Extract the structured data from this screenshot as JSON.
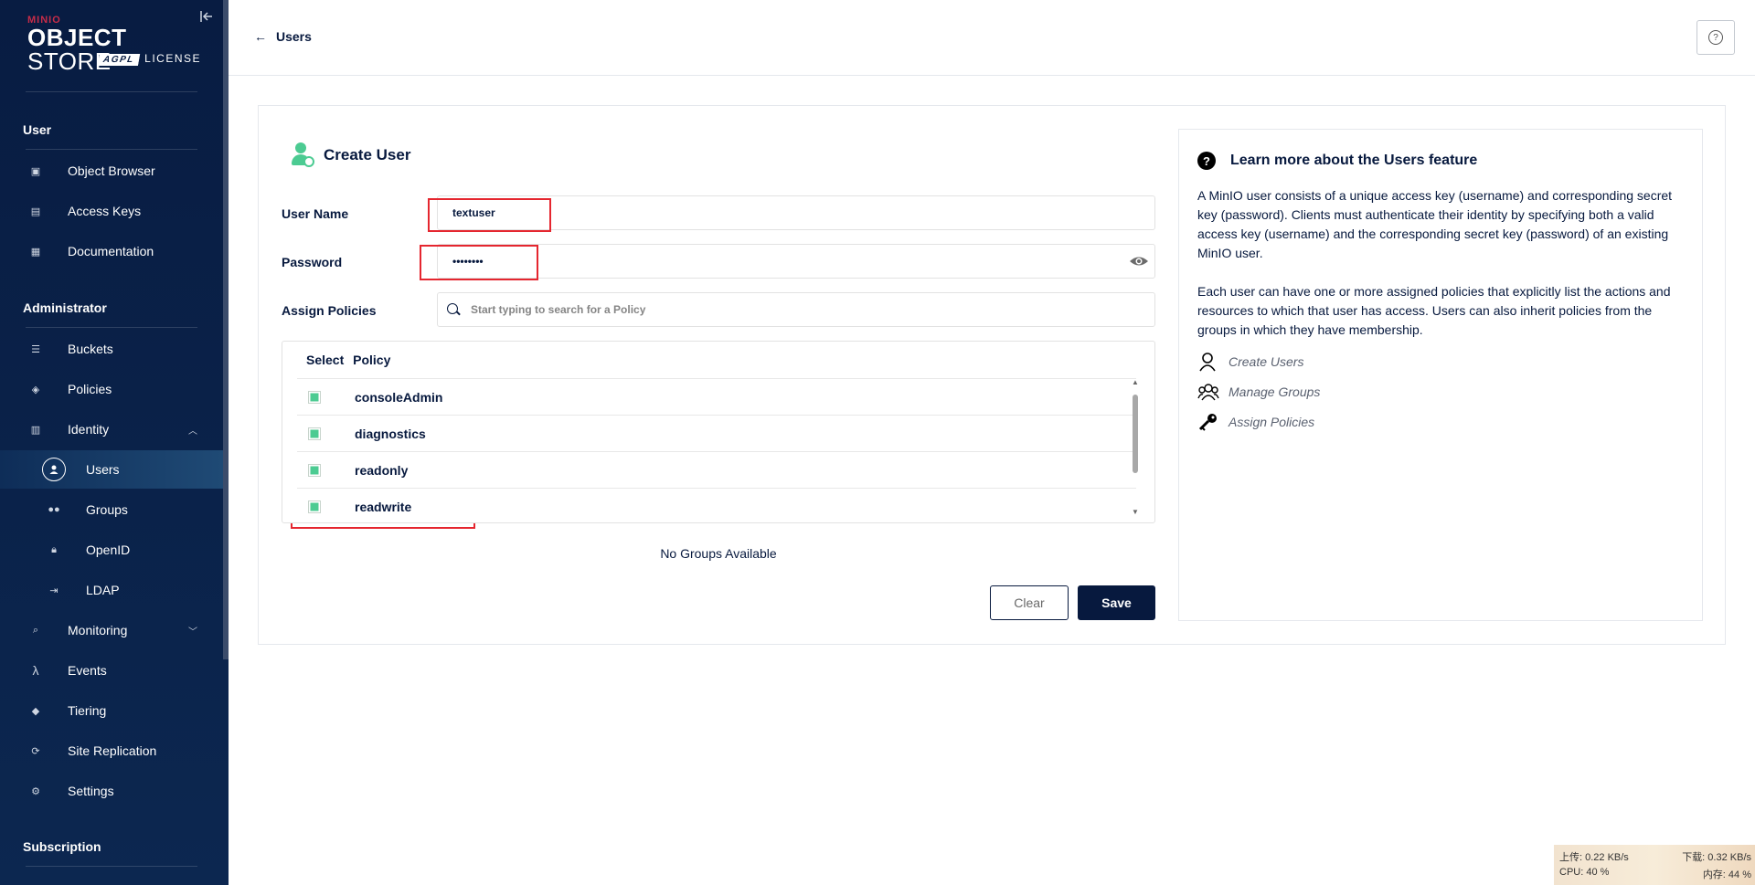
{
  "sidebar": {
    "logo": {
      "small": "MINIO",
      "big_bold": "OBJECT",
      "big_thin": "STORE",
      "agpl": "AGPL",
      "license": "LICENSE"
    },
    "collapse_icon": "collapse-icon",
    "sections": {
      "user": "User",
      "administrator": "Administrator",
      "subscription": "Subscription"
    },
    "items": {
      "object_browser": "Object Browser",
      "access_keys": "Access Keys",
      "documentation": "Documentation",
      "buckets": "Buckets",
      "policies": "Policies",
      "identity": "Identity",
      "users": "Users",
      "groups": "Groups",
      "openid": "OpenID",
      "ldap": "LDAP",
      "monitoring": "Monitoring",
      "events": "Events",
      "tiering": "Tiering",
      "site_replication": "Site Replication",
      "settings": "Settings"
    }
  },
  "topbar": {
    "back_label": "Users"
  },
  "form": {
    "title": "Create User",
    "username_label": "User Name",
    "username_value": "textuser",
    "password_label": "Password",
    "password_value": "••••••••",
    "policies_label": "Assign Policies",
    "policy_search_placeholder": "Start typing to search for a Policy",
    "table_headers": {
      "select": "Select",
      "policy": "Policy"
    },
    "policies": [
      {
        "name": "consoleAdmin",
        "checked": true
      },
      {
        "name": "diagnostics",
        "checked": true
      },
      {
        "name": "readonly",
        "checked": true
      },
      {
        "name": "readwrite",
        "checked": true
      }
    ],
    "no_groups": "No Groups Available",
    "clear_label": "Clear",
    "save_label": "Save"
  },
  "help": {
    "title": "Learn more about the Users feature",
    "para1": "A MinIO user consists of a unique access key (username) and corresponding secret key (password). Clients must authenticate their identity by specifying both a valid access key (username) and the corresponding secret key (password) of an existing MinIO user.",
    "para2": "Each user can have one or more assigned policies that explicitly list the actions and resources to which that user has access. Users can also inherit policies from the groups in which they have membership.",
    "links": {
      "create_users": "Create Users",
      "manage_groups": "Manage Groups",
      "assign_policies": "Assign Policies"
    }
  },
  "net_widget": {
    "upload": "上传: 0.22 KB/s",
    "download": "下载: 0.32 KB/s",
    "cpu": "CPU: 40 %",
    "memory": "内存: 44 %"
  },
  "colors": {
    "accent_green": "#4ccb92",
    "navy": "#07193e",
    "highlight_red": "#e5262f"
  }
}
